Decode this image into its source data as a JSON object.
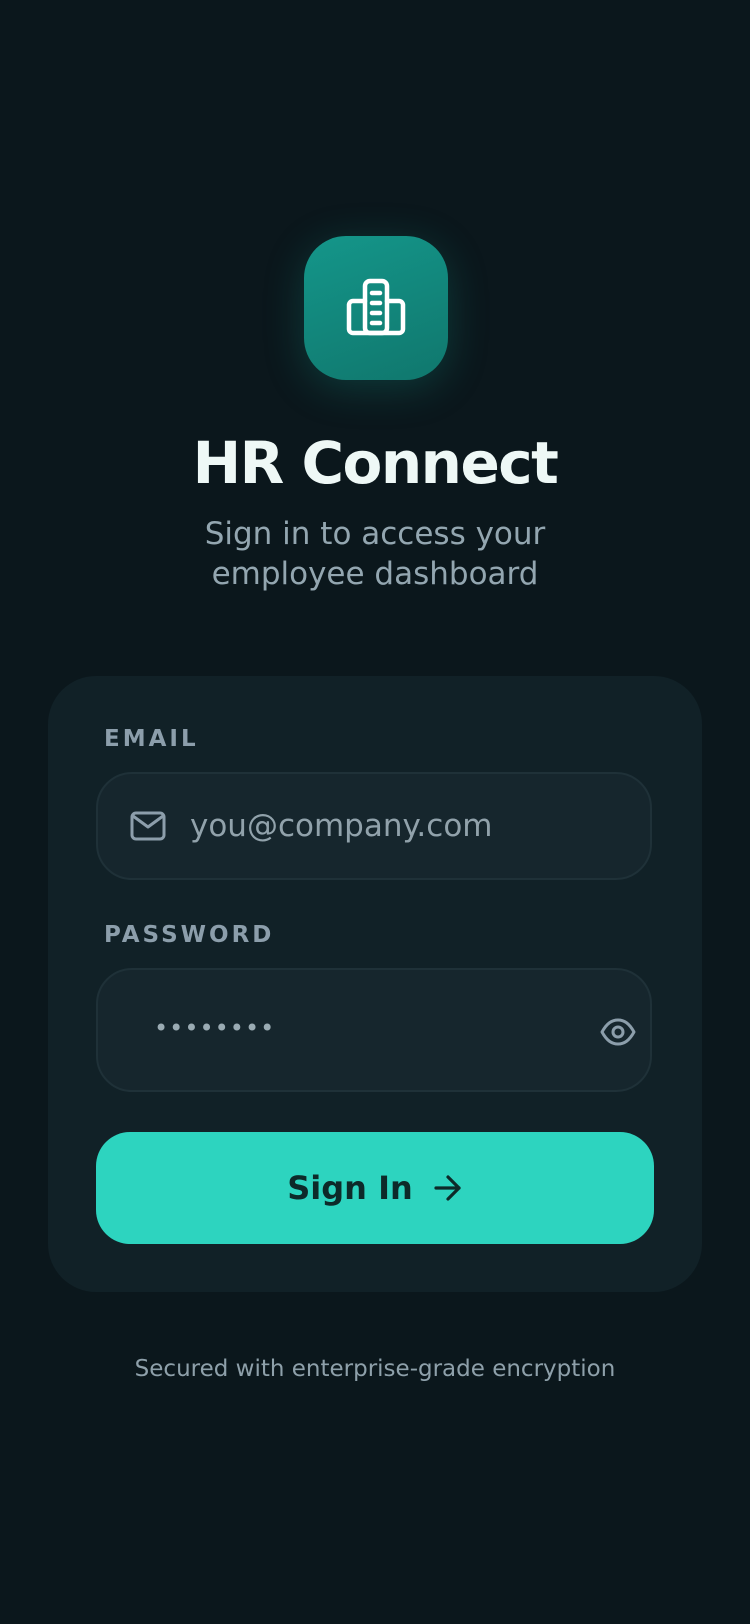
{
  "app": {
    "title": "HR Connect",
    "subtitle": "Sign in to access your employee dashboard",
    "logo_icon": "building-icon"
  },
  "form": {
    "email": {
      "label": "EMAIL",
      "placeholder": "you@company.com",
      "value": "",
      "icon": "mail-icon"
    },
    "password": {
      "label": "PASSWORD",
      "value": "••••••••",
      "toggle_icon": "eye-icon"
    },
    "submit": {
      "label": "Sign In",
      "icon": "arrow-right-icon"
    }
  },
  "footer": {
    "text": "Secured with enterprise-grade encryption"
  },
  "colors": {
    "background": "#0b171c",
    "card": "#112127",
    "accent": "#2dd4bf",
    "logo": "#14968a"
  }
}
